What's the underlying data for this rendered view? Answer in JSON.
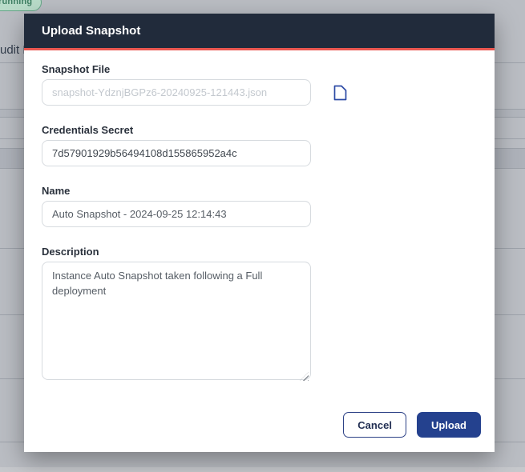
{
  "page": {
    "status_badge": "running",
    "background_text": "udit L"
  },
  "modal": {
    "title": "Upload Snapshot",
    "fields": {
      "snapshot_file": {
        "label": "Snapshot File",
        "placeholder": "snapshot-YdznjBGPz6-20240925-121443.json"
      },
      "credentials_secret": {
        "label": "Credentials Secret",
        "value": "7d57901929b56494108d155865952a4c"
      },
      "name": {
        "label": "Name",
        "value": "Auto Snapshot - 2024-09-25 12:14:43"
      },
      "description": {
        "label": "Description",
        "value": "Instance Auto Snapshot taken following a Full deployment"
      }
    },
    "buttons": {
      "cancel": "Cancel",
      "upload": "Upload"
    },
    "icons": {
      "snapshot_file_icon": "file-icon"
    }
  },
  "colors": {
    "header_bg": "#212b3b",
    "header_divider": "#ea5750",
    "primary_button_bg": "#24418e",
    "cancel_button_border": "#2c4186",
    "file_icon": "#2d4ba5",
    "badge_bg": "#b9dcc9",
    "badge_border": "#63a586",
    "badge_text": "#3f7f63",
    "dimmed_background": "#babdc3"
  }
}
